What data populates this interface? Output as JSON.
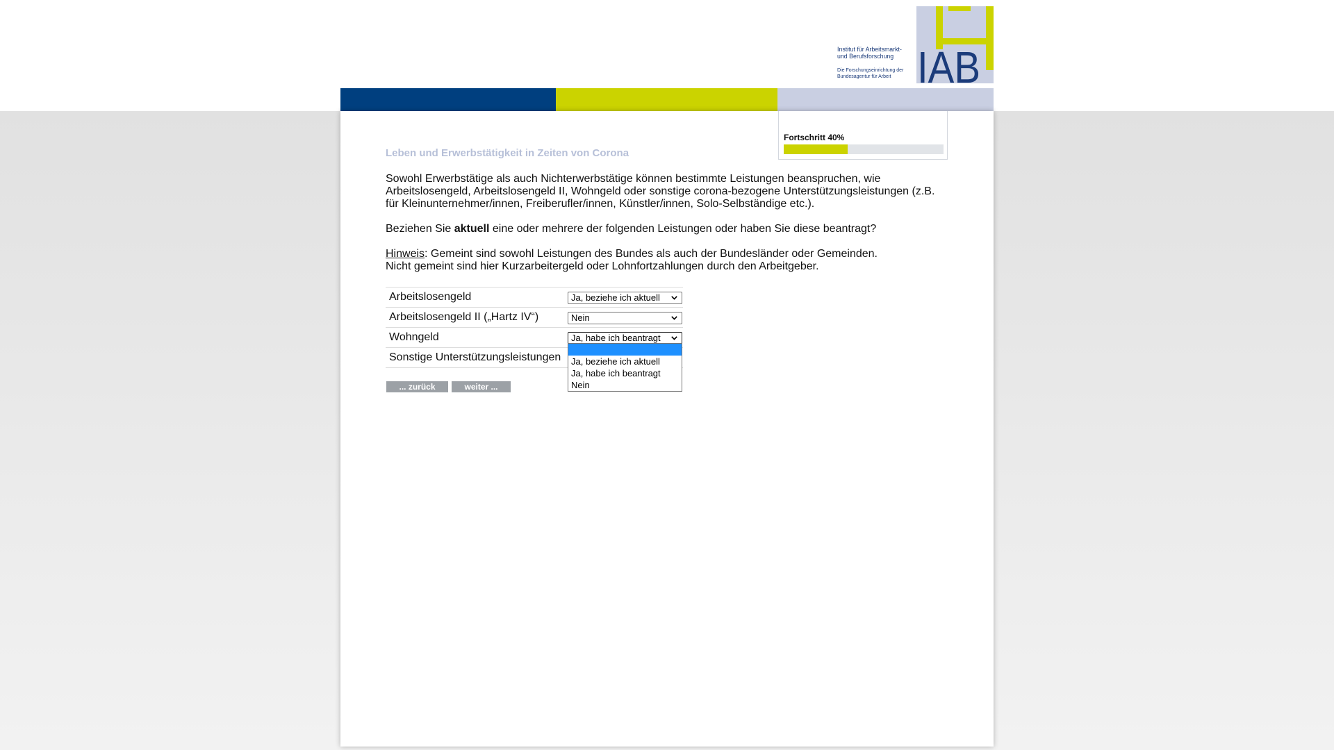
{
  "logo": {
    "org_line1": "Institut für Arbeitsmarkt-",
    "org_line2": "und Berufsforschung",
    "sub_line1": "Die Forschungseinrichtung der",
    "sub_line2": "Bundesagentur für Arbeit",
    "mark": "IAB"
  },
  "colors": {
    "brand_blue": "#003f7f",
    "brand_green": "#cbd300",
    "brand_lavender": "#c9cfe2",
    "title_text": "#b7c0d8",
    "option_highlight": "#1e90ff",
    "button_bg": "#9ca1a6",
    "logo_navy": "#1b3b7a"
  },
  "progress": {
    "label": "Fortschritt 40%",
    "value": 0.4
  },
  "survey": {
    "title": "Leben und Erwerbstätigkeit in Zeiten von Corona",
    "intro": "Sowohl Erwerbstätige als auch Nichterwerbstätige können bestimmte Leistungen beanspruchen, wie Arbeitslosengeld, Arbeitslosengeld II, Wohngeld oder sonstige corona-bezogene Unterstützungsleistungen (z.B. für Kleinunternehmer/innen, Freiberufler/innen, Künstler/innen, Solo-Selbständige etc.).",
    "question": {
      "before": "Beziehen Sie ",
      "emphasis": "aktuell",
      "after": " eine oder mehrere der folgenden Leistungen oder haben Sie diese beantragt?"
    },
    "hint": {
      "label": "Hinweis",
      "line1": ": Gemeint sind sowohl Leistungen des Bundes als auch der Bundesländer oder Gemeinden.",
      "line2": "Nicht gemeint sind hier Kurzarbeitergeld oder Lohnfortzahlungen durch den Arbeitgeber."
    }
  },
  "items": [
    {
      "label": "Arbeitslosengeld",
      "selected": "Ja, beziehe ich aktuell"
    },
    {
      "label": "Arbeitslosengeld II („Hartz IV“)",
      "selected": "Nein"
    },
    {
      "label": "Wohngeld",
      "selected": "Ja, habe ich beantragt"
    },
    {
      "label": "Sonstige Unterstützungsleistungen"
    }
  ],
  "dropdown": {
    "open_for": "Wohngeld",
    "options": [
      "",
      "Ja, beziehe ich aktuell",
      "Ja, habe ich beantragt",
      "Nein"
    ],
    "highlighted": ""
  },
  "buttons": {
    "back": "... zurück",
    "next": "weiter ..."
  },
  "icons": {
    "select_indicator": "chevron-down-icon"
  }
}
